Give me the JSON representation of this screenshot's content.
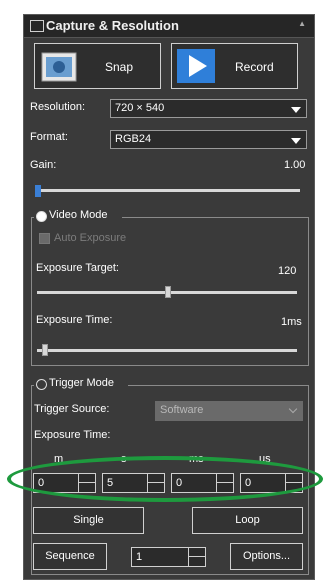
{
  "panel": {
    "title": "Capture & Resolution"
  },
  "buttons": {
    "snap_label": "Snap",
    "record_label": "Record"
  },
  "resolution": {
    "label": "Resolution:",
    "value": "720 × 540"
  },
  "format": {
    "label": "Format:",
    "value": "RGB24"
  },
  "gain": {
    "label": "Gain:",
    "value": "1.00",
    "level": 0.0
  },
  "video_mode": {
    "label": "Video Mode",
    "auto_exposure_label": "Auto Exposure",
    "exposure_target_label": "Exposure Target:",
    "exposure_target_value": "120",
    "exposure_target_level": 0.5,
    "exposure_time_label": "Exposure Time:",
    "exposure_time_value": "1ms",
    "exposure_time_level": 0.05
  },
  "trigger_mode": {
    "label": "Trigger Mode",
    "source_label": "Trigger Source:",
    "source_value": "Software",
    "exposure_time_label": "Exposure Time:",
    "units": [
      "m",
      "s",
      "ms",
      "us"
    ],
    "fields": [
      "0",
      "5",
      "0",
      "0"
    ],
    "single_label": "Single",
    "loop_label": "Loop",
    "sequence_label": "Sequence",
    "sequence_count": "1",
    "options_label": "Options..."
  },
  "colors": {
    "panel_bg": "#3a3a3a",
    "highlight_ring": "#1e9a3e",
    "record_icon": "#3a8ee6"
  }
}
